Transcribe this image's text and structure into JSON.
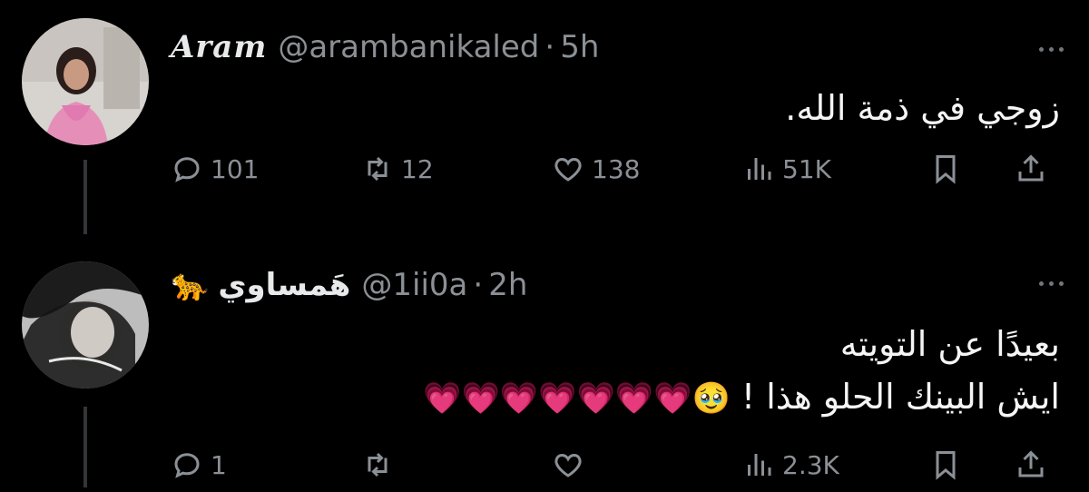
{
  "tweets": [
    {
      "display_name": "Aram",
      "handle": "@arambanikaled",
      "separator": "·",
      "time": "5h",
      "text_lines": [
        "زوجي في ذمة الله."
      ],
      "line_emojis": [
        ""
      ],
      "actions": {
        "replies": "101",
        "retweets": "12",
        "likes": "138",
        "views": "51K"
      }
    },
    {
      "display_name": "هَمساوي",
      "name_emoji": "🐆",
      "handle": "@1ii0a",
      "separator": "·",
      "time": "2h",
      "text_lines": [
        "بعيدًا عن التويته",
        "ايش البينك الحلو هذا !"
      ],
      "line_emojis": [
        "",
        "🥹💗💗💗💗💗💗💗"
      ],
      "actions": {
        "replies": "1",
        "retweets": "",
        "likes": "",
        "views": "2.3K"
      }
    }
  ],
  "icons": {
    "reply": "reply-icon",
    "retweet": "retweet-icon",
    "like": "heart-icon",
    "views": "views-icon",
    "bookmark": "bookmark-icon",
    "share": "share-icon",
    "more": "more-icon"
  },
  "colors": {
    "background": "#000000",
    "text": "#e7e9ea",
    "muted": "#8b9096",
    "thread_line": "#333639"
  }
}
